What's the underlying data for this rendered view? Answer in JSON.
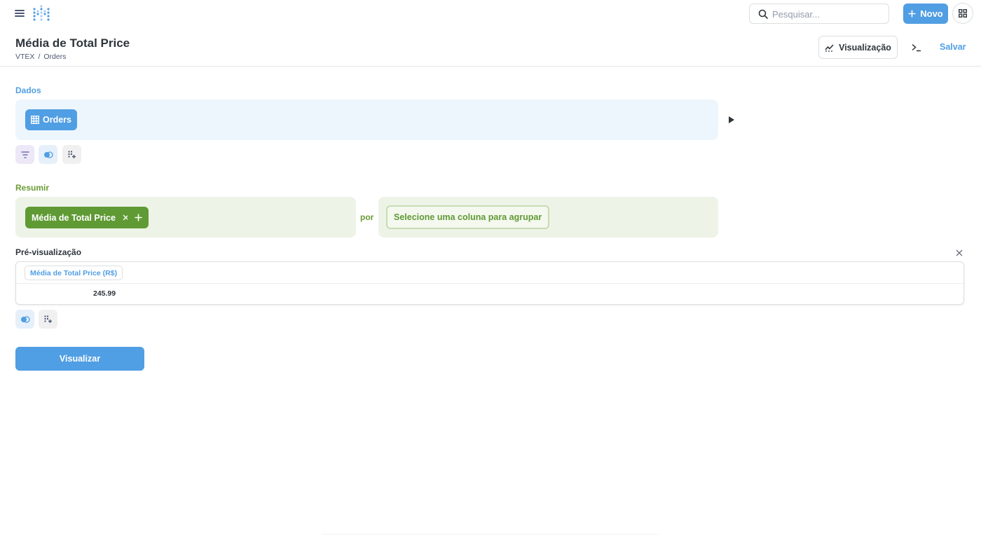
{
  "topbar": {
    "search_placeholder": "Pesquisar...",
    "new_label": "Novo"
  },
  "header": {
    "title": "Média de Total Price",
    "breadcrumb": [
      "VTEX",
      "/",
      "Orders"
    ],
    "visualization_label": "Visualização",
    "save_label": "Salvar"
  },
  "data_section": {
    "label": "Dados",
    "table_label": "Orders"
  },
  "summarize_section": {
    "label": "Resumir",
    "metric_label": "Média de Total Price",
    "by_label": "por",
    "group_placeholder": "Selecione uma coluna para agrupar"
  },
  "preview": {
    "label": "Pré-visualização",
    "columns": [
      "Média de Total Price (R$)"
    ],
    "rows": [
      [
        "245.99"
      ]
    ]
  },
  "actions": {
    "visualize_label": "Visualizar"
  },
  "colors": {
    "brand": "#509ee3",
    "summarize": "#5f9a34",
    "filter": "#7172ad"
  }
}
